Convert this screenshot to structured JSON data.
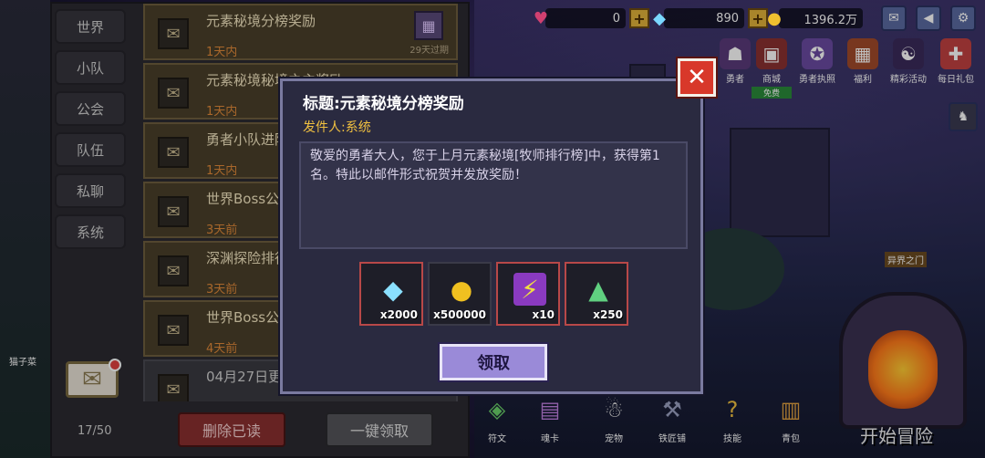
{
  "resources": {
    "hearts": "0",
    "gems": "890",
    "gold": "1396.2万"
  },
  "top_menu": [
    {
      "label": "勇者",
      "icon": "hero-icon"
    },
    {
      "label": "商城",
      "icon": "shop-icon",
      "badge": "免费"
    },
    {
      "label": "勇者执照",
      "icon": "license-icon"
    },
    {
      "label": "福利",
      "icon": "gift-box-icon"
    },
    {
      "label": "精彩活动",
      "icon": "event-icon"
    },
    {
      "label": "每日礼包",
      "icon": "daily-gift-icon"
    }
  ],
  "mail": {
    "tabs": [
      "世界",
      "小队",
      "公会",
      "队伍",
      "私聊",
      "系统"
    ],
    "items": [
      {
        "title": "元素秘境分榜奖励",
        "time": "1天内",
        "expire": "29天过期"
      },
      {
        "title": "元素秘境秘境之主奖励",
        "time": "1天内"
      },
      {
        "title": "勇者小队进阶",
        "time": "1天内"
      },
      {
        "title": "世界Boss公告",
        "time": "3天前"
      },
      {
        "title": "深渊探险排行",
        "time": "3天前"
      },
      {
        "title": "世界Boss公告",
        "time": "4天前"
      },
      {
        "title": "04月27日更",
        "time": ""
      }
    ],
    "count": "17/50",
    "delete_read": "删除已读",
    "claim_all": "一键领取"
  },
  "dialog": {
    "title": "标题:元素秘境分榜奖励",
    "sender": "发件人:系统",
    "body": "敬爱的勇者大人，您于上月元素秘境[牧师排行榜]中，获得第1名。特此以邮件形式祝贺并发放奖励！",
    "rewards": [
      {
        "icon": "diamond-icon",
        "qty": "x2000"
      },
      {
        "icon": "gold-coin-icon",
        "qty": "x500000"
      },
      {
        "icon": "energy-potion-icon",
        "qty": "x10"
      },
      {
        "icon": "rainbow-crystal-icon",
        "qty": "x250"
      }
    ],
    "claim": "领取",
    "close_symbol": "✕"
  },
  "bottom_bar": [
    "符文",
    "魂卡",
    "宠物",
    "铁匠铺",
    "技能",
    "青包"
  ],
  "start_adventure": "开始冒险",
  "portal_label": "异界之门",
  "left_label": "猫子菜"
}
